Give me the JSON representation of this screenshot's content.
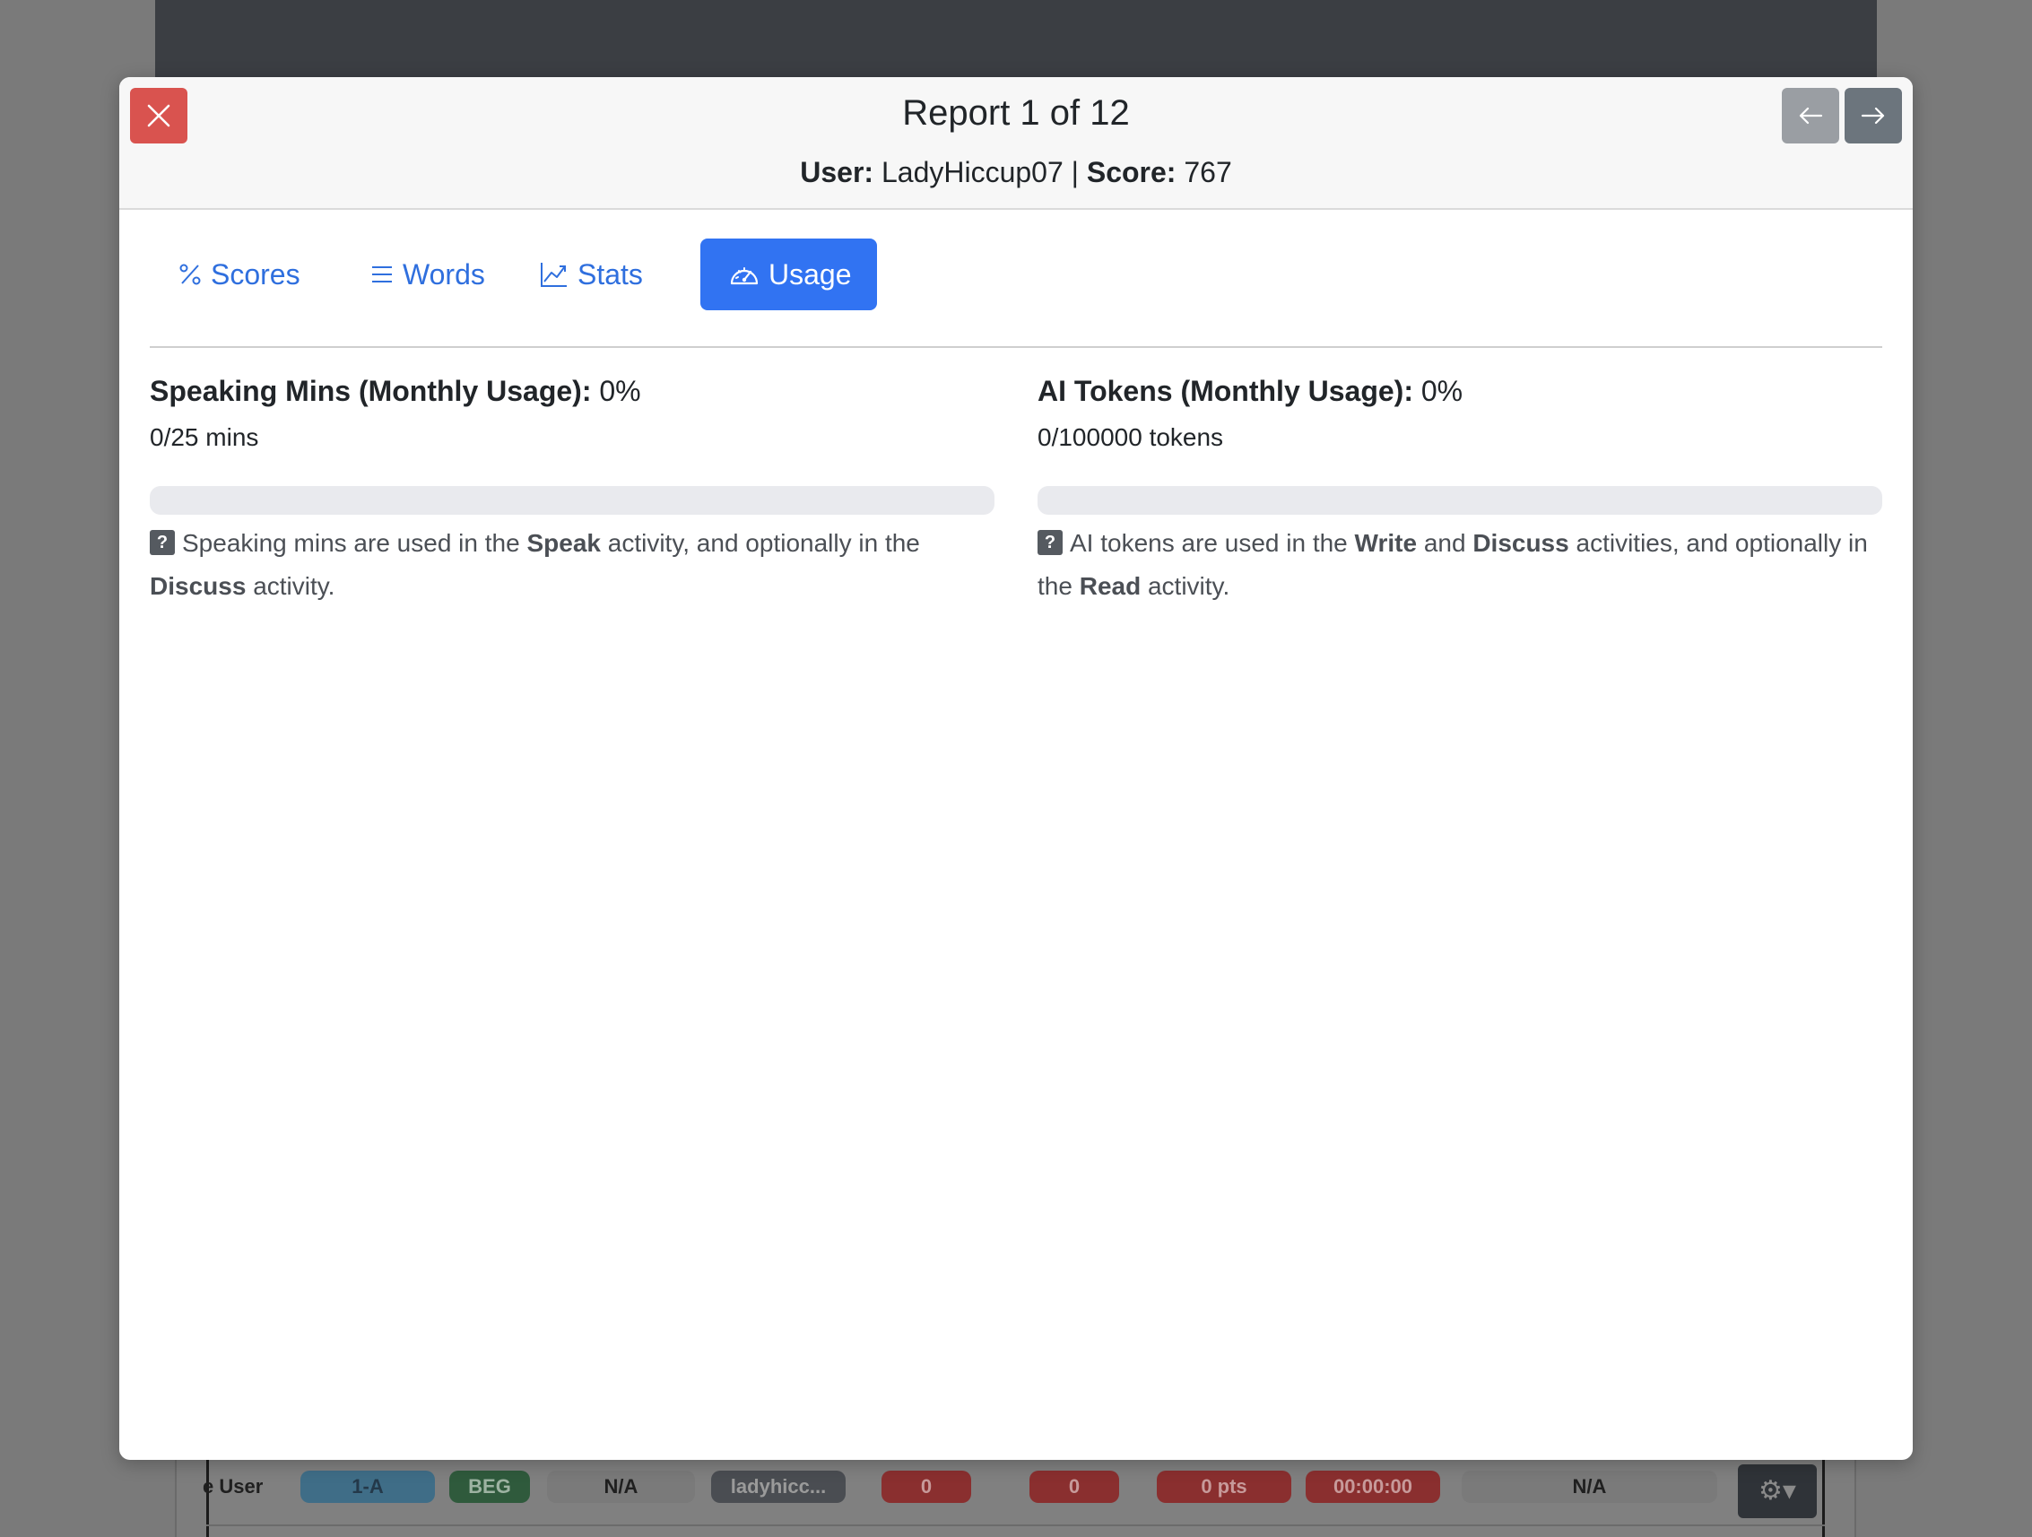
{
  "modal": {
    "title": "Report 1 of 12",
    "user_label": "User:",
    "user_value": "LadyHiccup07",
    "separator": "|",
    "score_label": "Score:",
    "score_value": "767"
  },
  "tabs": [
    {
      "label": "Scores",
      "icon": "percent-icon"
    },
    {
      "label": "Words",
      "icon": "list-icon"
    },
    {
      "label": "Stats",
      "icon": "line-chart-icon"
    },
    {
      "label": "Usage",
      "icon": "speedometer-icon",
      "active": true
    }
  ],
  "usage": {
    "speaking": {
      "heading": "Speaking Mins (Monthly Usage):",
      "percent": "0%",
      "amount": "0/25 mins",
      "progress": 0,
      "help": {
        "q": "?",
        "t1": "Speaking mins are used in the",
        "b1": "Speak",
        "t2": "activity, and optionally in the",
        "b2": "Discuss",
        "t3": "activity."
      }
    },
    "tokens": {
      "heading": "AI Tokens (Monthly Usage):",
      "percent": "0%",
      "amount": "0/100000 tokens",
      "progress": 0,
      "help": {
        "q": "?",
        "t1": "AI tokens are used in the",
        "b1": "Write",
        "t2": "and",
        "b2": "Discuss",
        "t3": "activities, and optionally in the",
        "b3": "Read",
        "t4": "activity."
      }
    }
  },
  "background_row": {
    "user": "e User",
    "class": "1-A",
    "level": "BEG",
    "na1": "N/A",
    "username": "ladyhicc...",
    "val1": "0",
    "val2": "0",
    "pts": "0 pts",
    "time": "00:00:00",
    "na2": "N/A"
  },
  "colors": {
    "accent": "#3173f2",
    "danger": "#d9534f",
    "secondary": "#6c757d"
  }
}
